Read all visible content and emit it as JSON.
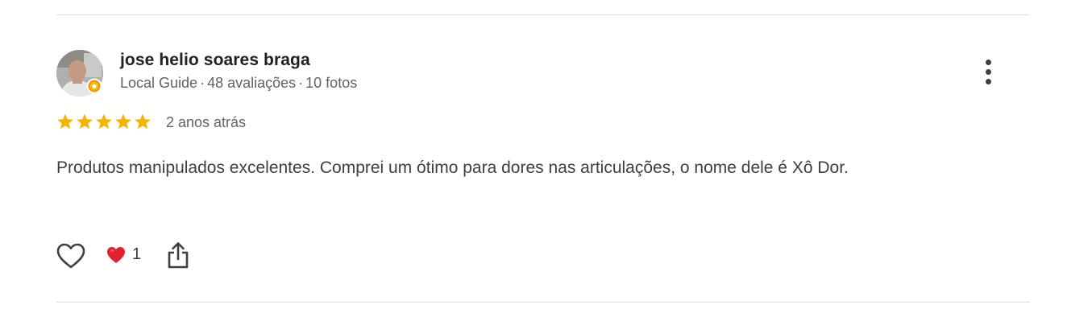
{
  "review": {
    "author": {
      "name": "jose helio soares braga",
      "level": "Local Guide",
      "separator": "·",
      "reviews": "48 avaliações",
      "photos": "10 fotos"
    },
    "rating": 5,
    "date": "2 anos atrás",
    "text": "Produtos manipulados excelentes. Comprei um ótimo para dores nas articulações, o nome dele é Xô Dor.",
    "reactions": {
      "emoji": "heart",
      "count": "1"
    }
  },
  "icons": {
    "more": "more-vert-icon",
    "like": "heart-outline-icon",
    "reaction": "red-heart-icon",
    "share": "share-icon",
    "star": "star-icon",
    "badge": "local-guide-badge-icon"
  },
  "colors": {
    "star": "#f4b400",
    "heart": "#e0222f",
    "text_primary": "#202124",
    "text_secondary": "#5f6368",
    "divider": "#dadce0"
  }
}
